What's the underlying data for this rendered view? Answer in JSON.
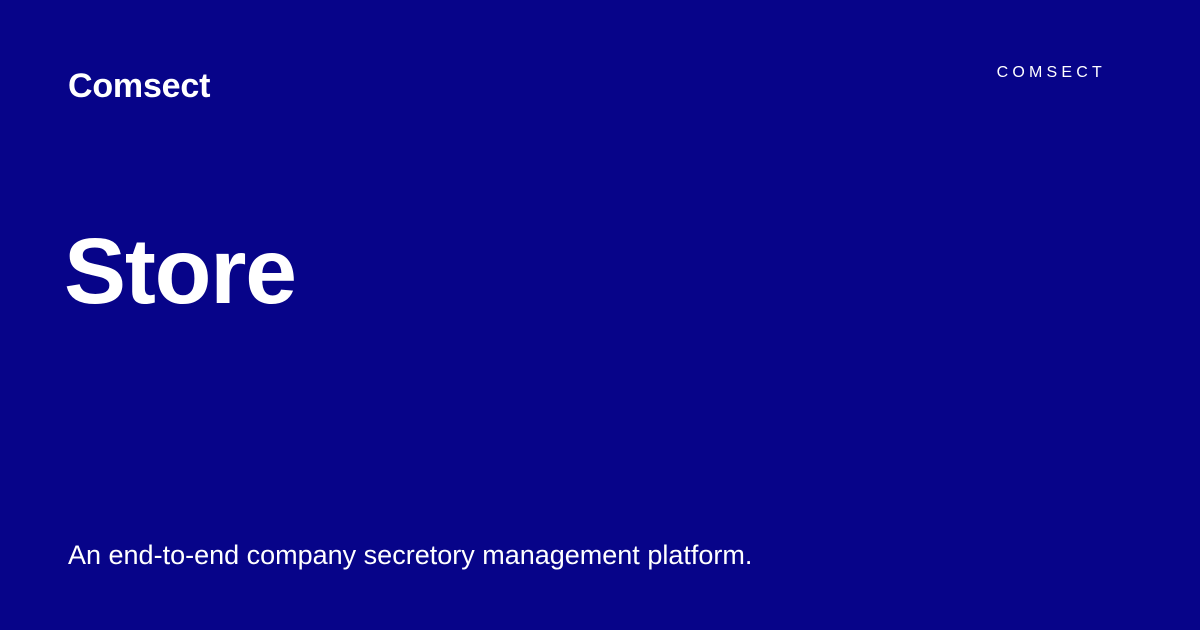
{
  "card": {
    "brand_name": "Comsect",
    "logo_text": "COMSECT",
    "title": "Store",
    "tagline": "An end-to-end company secretory management platform."
  },
  "colors": {
    "background": "#070489",
    "text": "#ffffff"
  }
}
